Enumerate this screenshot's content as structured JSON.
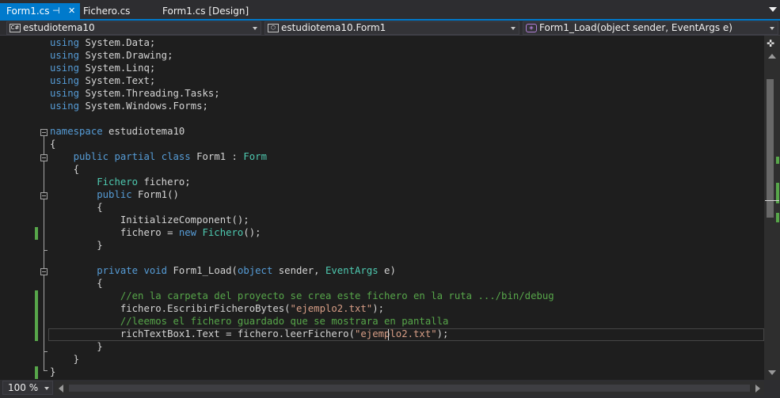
{
  "tabs": [
    {
      "label": "Form1.cs",
      "active": true
    },
    {
      "label": "Fichero.cs",
      "active": false
    },
    {
      "label": "Form1.cs [Design]",
      "active": false
    }
  ],
  "tab_icons": {
    "pin": "pin-icon",
    "close": "close-icon"
  },
  "navbar": {
    "project": "estudiotema10",
    "type": "estudiotema10.Form1",
    "member": "Form1_Load(object sender, EventArgs e)",
    "project_icon": "C#"
  },
  "code_lines": [
    "using System.Data;",
    "using System.Drawing;",
    "using System.Linq;",
    "using System.Text;",
    "using System.Threading.Tasks;",
    "using System.Windows.Forms;",
    "",
    "namespace estudiotema10",
    "{",
    "    public partial class Form1 : Form",
    "    {",
    "        Fichero fichero;",
    "        public Form1()",
    "        {",
    "            InitializeComponent();",
    "            fichero = new Fichero();",
    "        }",
    "",
    "        private void Form1_Load(object sender, EventArgs e)",
    "        {",
    "            //en la carpeta del proyecto se crea este fichero en la ruta .../bin/debug",
    "            fichero.EscribirFicheroBytes(\"ejemplo2.txt\");",
    "            //leemos el fichero guardado que se mostrara en pantalla",
    "            richTextBox1.Text = fichero.leerFichero(\"ejemplo2.txt\");",
    "        }",
    "    }",
    "}"
  ],
  "zoom": "100 %",
  "colors": {
    "keyword": "#569cd6",
    "type": "#4ec9b0",
    "comment": "#57a64a",
    "string": "#d69d85",
    "accent": "#007acc"
  }
}
